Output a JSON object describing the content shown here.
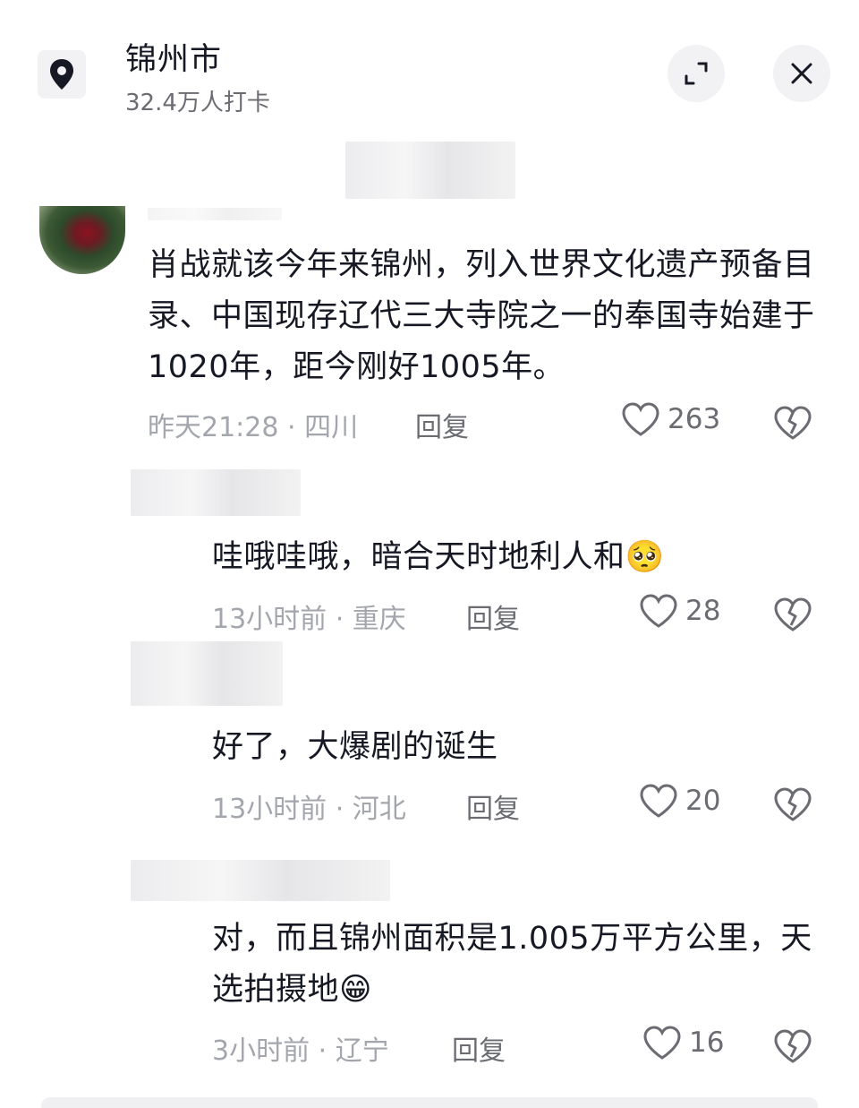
{
  "header": {
    "title": "锦州市",
    "subtitle": "32.4万人打卡"
  },
  "comments": [
    {
      "text": "肖战就该今年来锦州，列入世界文化遗产预备目录、中国现存辽代三大寺院之一的奉国寺始建于1020年，距今刚好1005年。",
      "meta": "昨天21:28 · 四川",
      "reply": "回复",
      "likes": "263"
    },
    {
      "text": "哇哦哇哦，暗合天时地利人和",
      "emoji": "🥺",
      "meta": "13小时前 · 重庆",
      "reply": "回复",
      "likes": "28"
    },
    {
      "text": "好了，大爆剧的诞生",
      "meta": "13小时前 · 河北",
      "reply": "回复",
      "likes": "20"
    },
    {
      "text": "对，而且锦州面积是1.005万平方公里，天选拍摄地",
      "emoji": "😁",
      "meta": "3小时前 · 辽宁",
      "reply": "回复",
      "likes": "16"
    }
  ]
}
